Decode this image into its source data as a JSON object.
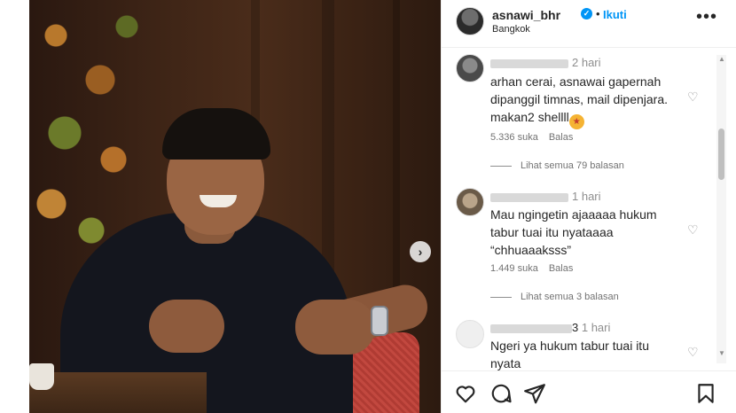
{
  "post": {
    "username": "asnawi_bhr",
    "separator": "•",
    "follow_label": "Ikuti",
    "location": "Bangkok",
    "more_label": "•••",
    "next_label": "›"
  },
  "comments": [
    {
      "time": "2 hari",
      "text": "arhan cerai, asnawai gapernah dipanggil timnas, mail dipenjara. makan2 shellll",
      "likes": "5.336 suka",
      "reply_label": "Balas",
      "view_replies": "Lihat semua 79 balasan"
    },
    {
      "time": "1 hari",
      "text": "Mau ngingetin ajaaaaa hukum tabur tuai itu nyataaaa “chhuaaaksss”",
      "likes": "1.449 suka",
      "reply_label": "Balas",
      "view_replies": "Lihat semua 3 balasan"
    },
    {
      "user_visible": "3",
      "time": "1 hari",
      "text": "Ngeri ya hukum tabur tuai itu nyata"
    }
  ],
  "icons": {
    "verified": "verified-badge-icon",
    "heart": "heart-icon",
    "comment": "comment-icon",
    "share": "share-icon",
    "save": "bookmark-icon",
    "emoji": "star-struck-emoji-icon"
  },
  "colors": {
    "accent": "#0095f6",
    "text": "#262626",
    "muted": "#737373"
  }
}
